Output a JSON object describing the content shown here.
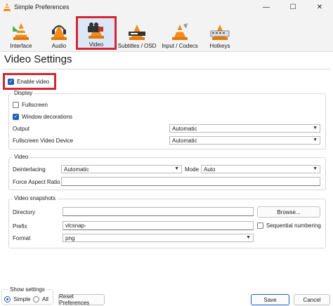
{
  "window": {
    "title": "Simple Preferences",
    "minimize_glyph": "—",
    "maximize_glyph": "☐",
    "close_glyph": "✕"
  },
  "toolbar": {
    "items": [
      {
        "label": "Interface",
        "icon": "interface-cone-icon"
      },
      {
        "label": "Audio",
        "icon": "audio-cone-icon"
      },
      {
        "label": "Video",
        "icon": "video-cone-icon",
        "selected": true
      },
      {
        "label": "Subtitles / OSD",
        "icon": "subtitles-cone-icon"
      },
      {
        "label": "Input / Codecs",
        "icon": "input-codecs-cone-icon"
      },
      {
        "label": "Hotkeys",
        "icon": "hotkeys-cone-icon"
      }
    ]
  },
  "page": {
    "heading": "Video Settings",
    "enable_video": {
      "label": "Enable video",
      "checked": true
    }
  },
  "display": {
    "title": "Display",
    "fullscreen": {
      "label": "Fullscreen",
      "checked": false
    },
    "window_decorations": {
      "label": "Window decorations",
      "checked": true
    },
    "output_label": "Output",
    "output_value": "Automatic",
    "fullscreen_device_label": "Fullscreen Video Device",
    "fullscreen_device_value": "Automatic"
  },
  "video": {
    "title": "Video",
    "deinterlacing_label": "Deinterlacing",
    "deinterlacing_value": "Automatic",
    "mode_label": "Mode",
    "mode_value": "Auto",
    "aspect_label": "Force Aspect Ratio",
    "aspect_value": ""
  },
  "snapshots": {
    "title": "Video snapshots",
    "directory_label": "Directory",
    "directory_value": "",
    "browse_label": "Browse...",
    "prefix_label": "Prefix",
    "prefix_value": "vlcsnap-",
    "sequential_label": "Sequential numbering",
    "sequential_checked": false,
    "format_label": "Format",
    "format_value": "png"
  },
  "footer": {
    "show_settings_title": "Show settings",
    "simple_label": "Simple",
    "all_label": "All",
    "selected": "Simple",
    "reset_label": "Reset Preferences",
    "save_label": "Save",
    "cancel_label": "Cancel"
  },
  "colors": {
    "highlight_border": "#d6262f",
    "accent": "#1f5fb9",
    "cone_orange": "#f28c1b"
  }
}
